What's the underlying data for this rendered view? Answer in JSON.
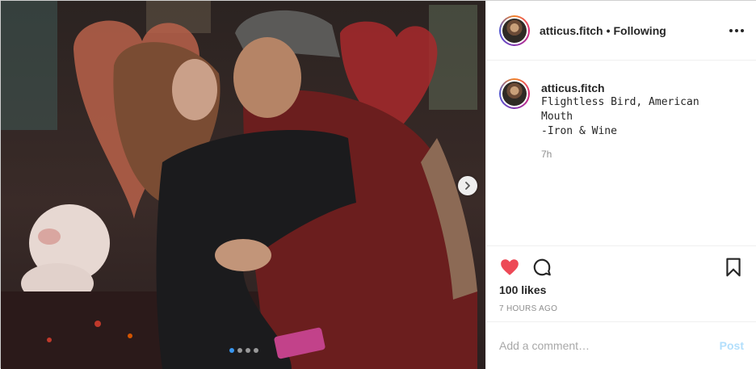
{
  "post": {
    "username": "atticus.fitch",
    "separator": "•",
    "follow_status": "Following",
    "more_options_icon": "more-horizontal-icon",
    "caption": {
      "username": "atticus.fitch",
      "text": "Flightless Bird, American Mouth\n-Iron & Wine",
      "time_ago": "7h"
    },
    "actions": {
      "like_icon": "heart-filled-icon",
      "comment_icon": "comment-bubble-icon",
      "save_icon": "bookmark-icon",
      "liked": true
    },
    "likes_text": "100 likes",
    "posted_ago": "7 HOURS AGO",
    "comment": {
      "placeholder": "Add a comment…",
      "post_label": "Post"
    },
    "carousel": {
      "slide_count": 4,
      "active_index": 0,
      "next_icon": "chevron-right-icon"
    }
  },
  "colors": {
    "like_red": "#ed4956",
    "muted_text": "#8e8e8e",
    "post_button_disabled": "#b2dffc",
    "active_dot": "#3897f0"
  }
}
